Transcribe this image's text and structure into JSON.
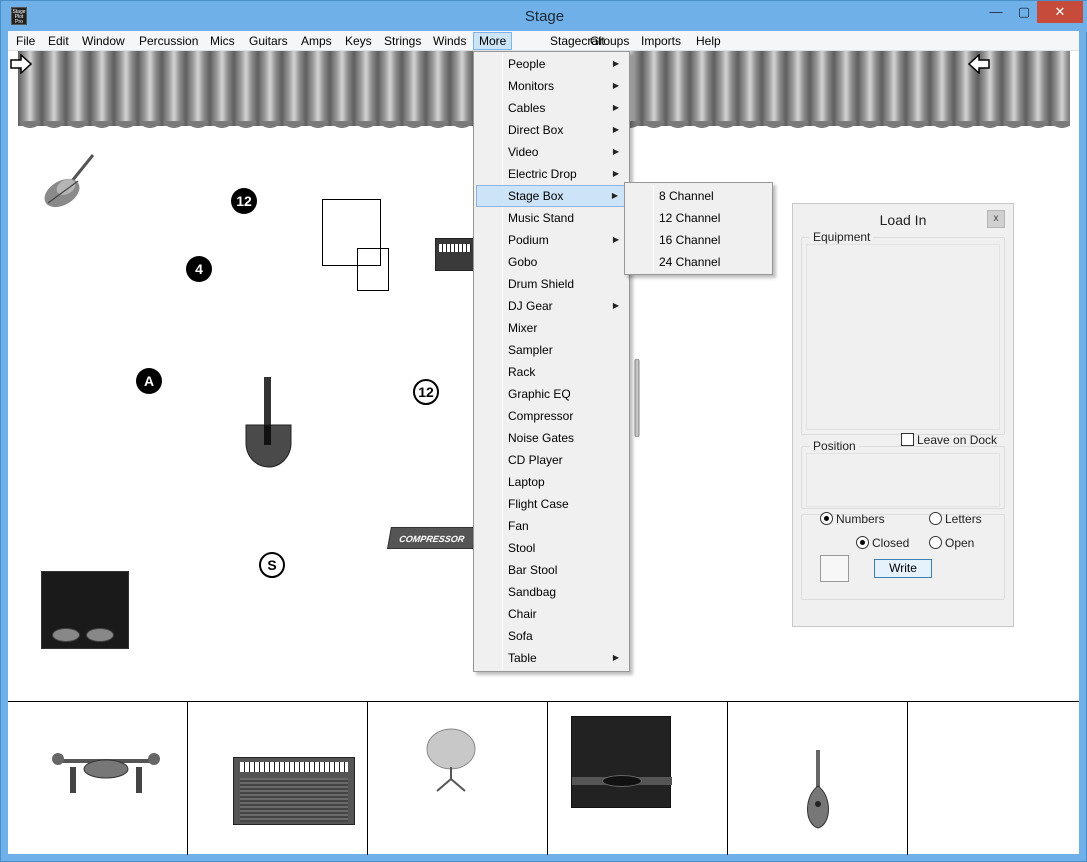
{
  "window": {
    "title": "Stage",
    "icon_text": "Stage Plot Pro",
    "minimize": "—",
    "maximize": "▢",
    "close": "✕"
  },
  "menubar": [
    "File",
    "Edit",
    "Window",
    "Percussion",
    "Mics",
    "Guitars",
    "Amps",
    "Keys",
    "Strings",
    "Winds",
    "More",
    "Stagecraft",
    "Groups",
    "Imports",
    "Help"
  ],
  "more_menu": {
    "items": [
      {
        "label": "People",
        "submenu": true
      },
      {
        "label": "Monitors",
        "submenu": true
      },
      {
        "label": "Cables",
        "submenu": true
      },
      {
        "label": "Direct Box",
        "submenu": true
      },
      {
        "label": "Video",
        "submenu": true
      },
      {
        "label": "Electric Drop",
        "submenu": true
      },
      {
        "label": "Stage Box",
        "submenu": true
      },
      {
        "label": "Music Stand",
        "submenu": false
      },
      {
        "label": "Podium",
        "submenu": true
      },
      {
        "label": "Gobo",
        "submenu": false
      },
      {
        "label": "Drum Shield",
        "submenu": false
      },
      {
        "label": "DJ Gear",
        "submenu": true
      },
      {
        "label": "Mixer",
        "submenu": false
      },
      {
        "label": "Sampler",
        "submenu": false
      },
      {
        "label": "Rack",
        "submenu": false
      },
      {
        "label": "Graphic EQ",
        "submenu": false
      },
      {
        "label": "Compressor",
        "submenu": false
      },
      {
        "label": "Noise Gates",
        "submenu": false
      },
      {
        "label": "CD Player",
        "submenu": false
      },
      {
        "label": "Laptop",
        "submenu": false
      },
      {
        "label": "Flight Case",
        "submenu": false
      },
      {
        "label": "Fan",
        "submenu": false
      },
      {
        "label": "Stool",
        "submenu": false
      },
      {
        "label": "Bar Stool",
        "submenu": false
      },
      {
        "label": "Sandbag",
        "submenu": false
      },
      {
        "label": "Chair",
        "submenu": false
      },
      {
        "label": "Sofa",
        "submenu": false
      },
      {
        "label": "Table",
        "submenu": true
      }
    ],
    "arrow": "▶"
  },
  "stage_box_submenu": [
    "8 Channel",
    "12 Channel",
    "16 Channel",
    "24 Channel"
  ],
  "stage": {
    "badges": {
      "b12a": "12",
      "b4": "4",
      "bA": "A",
      "b12b": "12",
      "bS": "S"
    },
    "compressor_label": "COMPRESSOR"
  },
  "load_in": {
    "title": "Load In",
    "close": "x",
    "equipment_label": "Equipment",
    "leave_on_dock": "Leave on Dock",
    "position_label": "Position",
    "numbers": "Numbers",
    "letters": "Letters",
    "closed": "Closed",
    "open": "Open",
    "write": "Write"
  },
  "dock_items": [
    "drum-pedal",
    "keyboard-amp",
    "cymbal-stand",
    "amp-cabinet",
    "mandolin"
  ]
}
